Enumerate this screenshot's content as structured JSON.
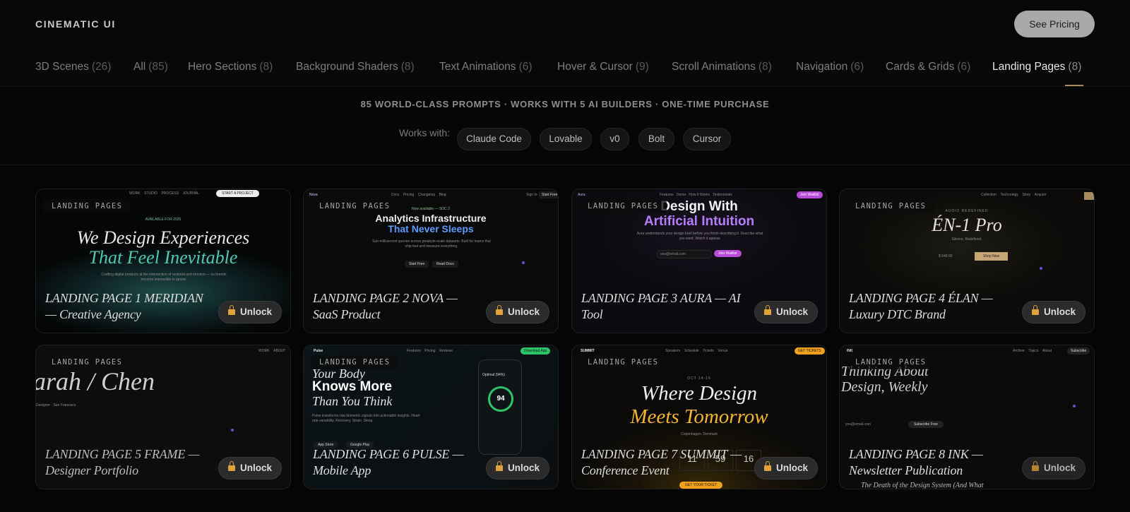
{
  "header": {
    "brand": "CINEMATIC UI",
    "pricing_label": "See Pricing"
  },
  "tabs": [
    {
      "label": "3D Scenes",
      "count": "(26)"
    },
    {
      "label": "All",
      "count": "(85)"
    },
    {
      "label": "Hero Sections",
      "count": "(8)"
    },
    {
      "label": "Background Shaders",
      "count": "(8)"
    },
    {
      "label": "Text Animations",
      "count": "(6)"
    },
    {
      "label": "Hover & Cursor",
      "count": "(9)"
    },
    {
      "label": "Scroll Animations",
      "count": "(8)"
    },
    {
      "label": "Navigation",
      "count": "(6)"
    },
    {
      "label": "Cards & Grids",
      "count": "(6)"
    },
    {
      "label": "Landing Pages",
      "count": "(8)",
      "active": true
    }
  ],
  "banner": {
    "tagline": "85 WORLD-CLASS PROMPTS · WORKS WITH 5 AI BUILDERS · ONE-TIME PURCHASE",
    "works_with_label": "Works with:",
    "builders": [
      "Claude Code",
      "Lovable",
      "v0",
      "Bolt",
      "Cursor"
    ]
  },
  "cards": [
    {
      "category": "LANDING PAGES",
      "title": "LANDING PAGE 1 MERIDIAN — Creative Agency",
      "unlock": "Unlock",
      "preview": {
        "nav": [
          "WORK",
          "STUDIO",
          "PROCESS",
          "JOURNAL"
        ],
        "cta": "START A PROJECT",
        "badge": "AVAILABLE FOR 2025",
        "headline_1": "We Design Experiences",
        "headline_2": "That Feel Inevitable",
        "body": "Crafting digital products at the intersection of restraint and emotion — so brands become impossible to ignore."
      }
    },
    {
      "category": "LANDING PAGES",
      "title": "LANDING PAGE 2 NOVA — SaaS Product",
      "unlock": "Unlock",
      "preview": {
        "logo": "Nova",
        "nav": [
          "Docs",
          "Pricing",
          "Changelog",
          "Blog"
        ],
        "signin": "Sign In",
        "cta": "Start Free",
        "badge": "Now available — SOC 2",
        "headline_1": "Analytics Infrastructure",
        "headline_2": "That Never Sleeps",
        "body": "Sub-millisecond queries across petabyte-scale datasets. Built for teams that ship fast and measure everything.",
        "btn_1": "Start Free",
        "btn_2": "Read Docs"
      }
    },
    {
      "category": "LANDING PAGES",
      "title": "LANDING PAGE 3 AURA — AI Tool",
      "unlock": "Unlock",
      "preview": {
        "logo": "Aura",
        "nav": [
          "Features",
          "Demo",
          "How It Works",
          "Testimonials"
        ],
        "cta": "Join Waitlist",
        "headline_1": "Design With",
        "headline_2": "Artificial Intuition",
        "body": "Aura understands your design brief before you finish describing it. Describe what you want. Watch it appear.",
        "input": "you@email.com",
        "btn": "Join Waitlist"
      }
    },
    {
      "category": "LANDING PAGES",
      "title": "LANDING PAGE 4 ÉLAN — Luxury DTC Brand",
      "unlock": "Unlock",
      "preview": {
        "nav": [
          "Collection",
          "Technology",
          "Story",
          "Acquire"
        ],
        "kicker": "AUDIO REDEFINED",
        "headline_1": "ÉN-1 Pro",
        "sub": "Silence, Redefined.",
        "price": "$ 649.00",
        "btn": "Shop Now"
      }
    },
    {
      "category": "LANDING PAGES",
      "title": "LANDING PAGE 5 FRAME — Designer Portfolio",
      "unlock": "Unlock",
      "preview": {
        "nav": [
          "WORK",
          "ABOUT"
        ],
        "headline_1": "arah / Chen",
        "sub": "Designer · San Francisco"
      }
    },
    {
      "category": "LANDING PAGES",
      "title": "LANDING PAGE 6 PULSE — Mobile App",
      "unlock": "Unlock",
      "preview": {
        "logo": "Pulse",
        "nav": [
          "Features",
          "Pricing",
          "Reviews"
        ],
        "cta": "Download App",
        "headline_1": "Your Body",
        "headline_2": "Knows More",
        "headline_3": "Than You Think",
        "body": "Pulse transforms raw biometric signals into actionable insights. Heart rate variability. Recovery. Strain. Sleep.",
        "store_1": "App Store",
        "store_2": "Google Play",
        "score": "94",
        "phone_label": "Optimal (94%)"
      }
    },
    {
      "category": "LANDING PAGES",
      "title": "LANDING PAGE 7 SUMMIT — Conference Event",
      "unlock": "Unlock",
      "preview": {
        "logo": "SUMMIT",
        "nav": [
          "Speakers",
          "Schedule",
          "Tickets",
          "Venue"
        ],
        "cta": "GET TICKETS",
        "kicker": "OCT 14-16",
        "headline_1": "Where Design",
        "headline_2": "Meets Tomorrow",
        "location": "Copenhagen, Denmark",
        "countdown": [
          "45",
          "11",
          "59",
          "16"
        ],
        "btn": "GET YOUR TICKET"
      }
    },
    {
      "category": "LANDING PAGES",
      "title": "LANDING PAGE 8 INK — Newsletter Publication",
      "unlock": "Unlock",
      "preview": {
        "logo": "INK",
        "nav": [
          "Archive",
          "Topics",
          "About"
        ],
        "cta": "Subscribe",
        "headline_1": "Thinking About",
        "headline_2": "Design, Weekly",
        "input": "you@email.com",
        "btn": "Subscribe Free",
        "footer": "The Death of the Design System (And What"
      }
    }
  ]
}
